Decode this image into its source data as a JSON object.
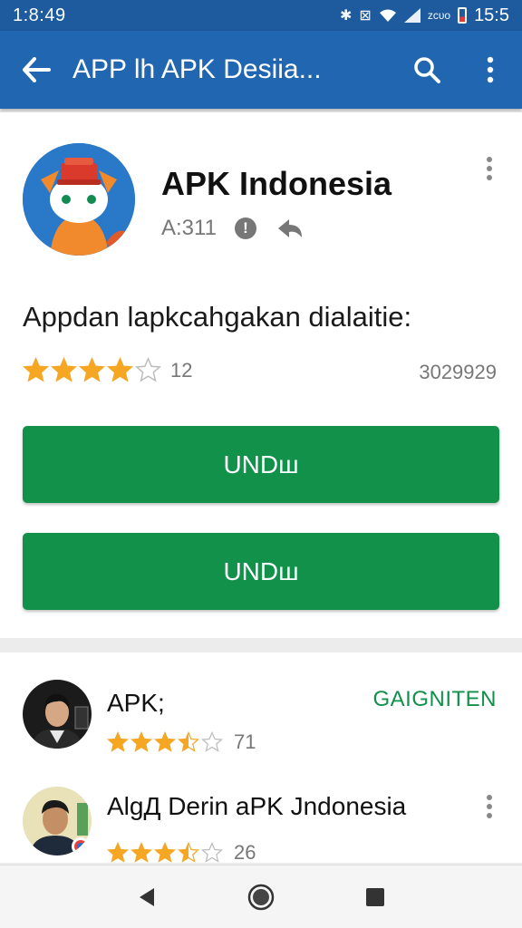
{
  "status_bar": {
    "time_left": "1:8:49",
    "carrier_text": "ᴢᴄᴜᴏ",
    "time_right": "15:5"
  },
  "app_bar": {
    "title": "APP lh APK Desiia..."
  },
  "app": {
    "name": "APK Indonesia",
    "meta_code": "A:311",
    "description": "Appdan lapkcahgakan dialaitie:",
    "rating_value": 4.0,
    "rating_count": "12",
    "downloads": "3029929"
  },
  "buttons": {
    "primary": "UNDш",
    "secondary": "UNDш"
  },
  "list": {
    "items": [
      {
        "name": "APK;",
        "rating_value": 3.5,
        "count": "71",
        "action": "GAIGNITEN"
      },
      {
        "name": "AlgД Derin aPK Jndonesia",
        "rating_value": 3.5,
        "count": "26"
      }
    ]
  },
  "colors": {
    "status_bar": "#1d5a9e",
    "app_bar": "#2166b0",
    "accent_green": "#12914a",
    "star": "#f5a623"
  }
}
